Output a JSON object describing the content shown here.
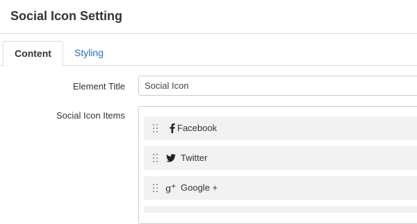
{
  "header": {
    "title": "Social Icon Setting"
  },
  "tabs": [
    {
      "label": "Content"
    },
    {
      "label": "Styling"
    }
  ],
  "form": {
    "element_title_label": "Element Title",
    "element_title_value": "Social Icon",
    "items_label": "Social Icon Items"
  },
  "items": [
    {
      "label": "Facebook",
      "icon": "facebook-icon"
    },
    {
      "label": "Twitter",
      "icon": "twitter-icon"
    },
    {
      "label": "Google +",
      "icon": "google-plus-icon"
    }
  ]
}
